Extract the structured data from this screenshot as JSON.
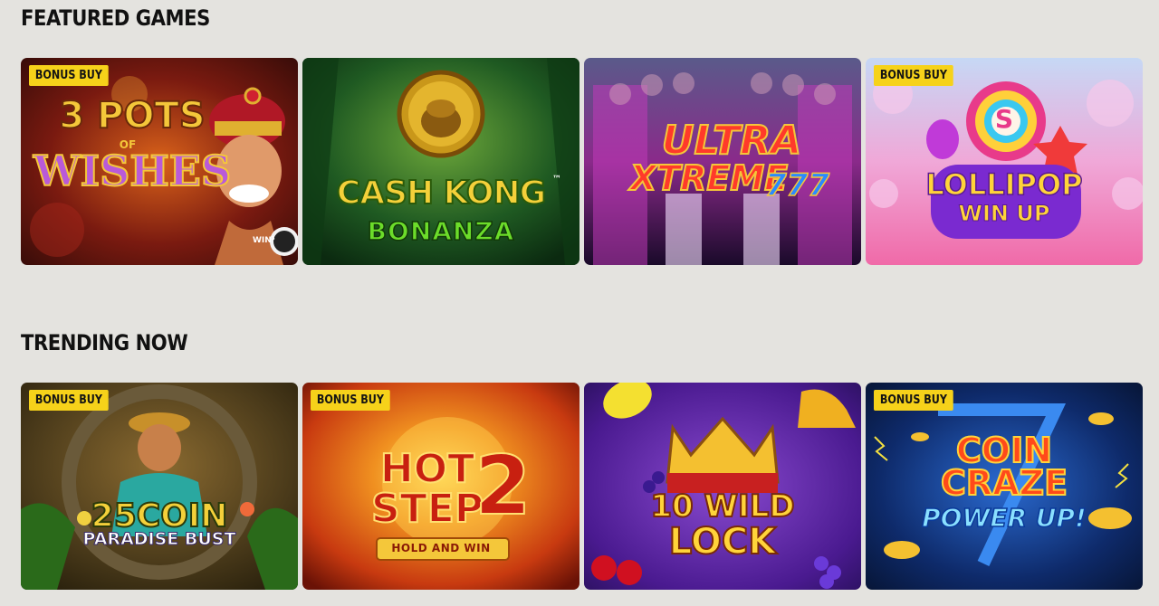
{
  "sections": [
    {
      "title": "FEATURED GAMES",
      "games": [
        {
          "name": "3 Pots of Wishes",
          "badge": "BONUS BUY",
          "logo_line1": "3 POTS",
          "logo_line2": "OF",
          "logo_line3": "WISHES",
          "extra": "WIN³"
        },
        {
          "name": "Cash Kong Bonanza",
          "badge": "",
          "logo_line1": "CASH KONG",
          "logo_line2": "BONANZA",
          "extra": "™"
        },
        {
          "name": "Ultra Xtreme 777",
          "badge": "",
          "logo_line1": "ULTRA",
          "logo_line2": "XTREME",
          "extra": "777"
        },
        {
          "name": "Lollipop Win Up",
          "badge": "BONUS BUY",
          "logo_line1": "LOLLIPOP",
          "logo_line2": "WIN UP",
          "extra": "S"
        }
      ]
    },
    {
      "title": "TRENDING NOW",
      "games": [
        {
          "name": "25 Coin Paradise Bust",
          "badge": "BONUS BUY",
          "logo_line1": "25COIN",
          "logo_line2": "PARADISE BUST"
        },
        {
          "name": "Hot Step 2",
          "badge": "BONUS BUY",
          "logo_line1": "HOT",
          "logo_line2": "STEP",
          "logo_line3": "HOLD AND WIN",
          "extra": "2"
        },
        {
          "name": "10 Wild Lock",
          "badge": "",
          "logo_line1": "10 WILD",
          "logo_line2": "LOCK"
        },
        {
          "name": "Coin Craze Power Up",
          "badge": "BONUS BUY",
          "logo_line1": "COIN",
          "logo_line2": "CRAZE",
          "logo_line3": "POWER UP!"
        }
      ]
    }
  ],
  "colors": {
    "page_bg": "#e4e3df",
    "badge_bg": "#f6d21a",
    "title_text": "#111111"
  }
}
